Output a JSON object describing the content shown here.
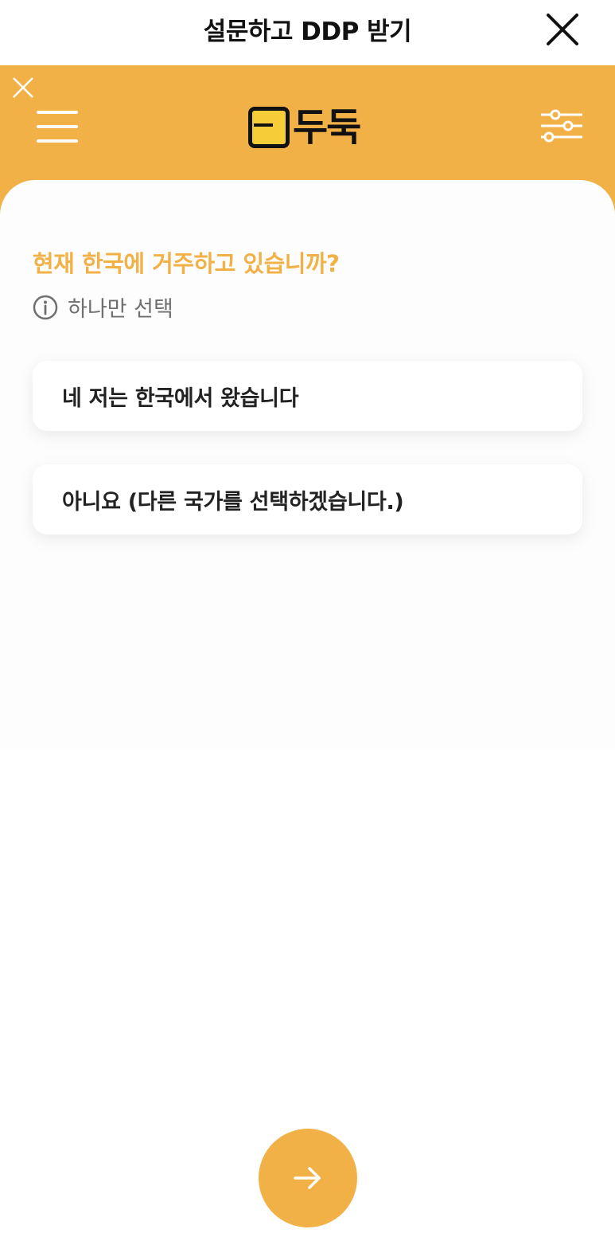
{
  "topbar": {
    "title": "설문하고 DDP 받기",
    "close_icon": "close-icon"
  },
  "header": {
    "dismiss_icon": "close-icon",
    "menu_icon": "hamburger-menu-icon",
    "logo_text": "두둑",
    "filter_icon": "sliders-icon",
    "background_color": "#F2B147"
  },
  "survey": {
    "question": "현재 한국에 거주하고 있습니까?",
    "hint_icon": "info-icon",
    "hint": "하나만 선택",
    "options": [
      {
        "label": "네 저는 한국에서 왔습니다"
      },
      {
        "label": "아니요 (다른 국가를 선택하겠습니다.)"
      }
    ]
  },
  "footer": {
    "next_icon": "arrow-right-icon",
    "accent_color": "#F2B147"
  }
}
